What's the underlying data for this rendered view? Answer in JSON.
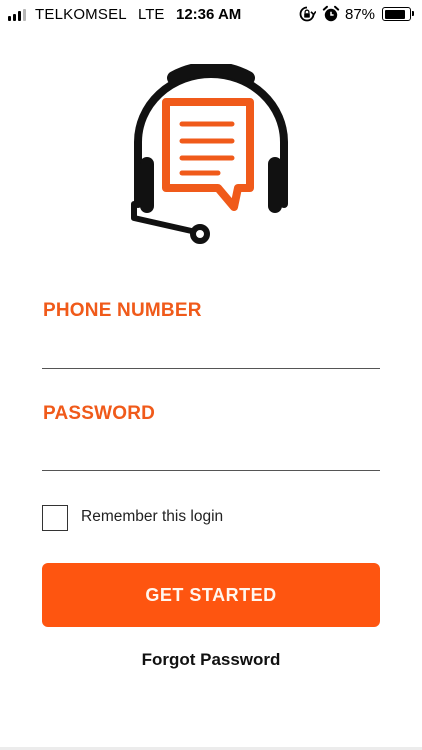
{
  "status_bar": {
    "carrier": "TELKOMSEL",
    "network": "LTE",
    "time": "12:36 AM",
    "battery_percent": "87%",
    "battery_level": 0.87,
    "signal_bars_filled": 3,
    "signal_bars_total": 4,
    "icons": [
      "signal-icon",
      "rotation-lock-icon",
      "alarm-icon",
      "battery-icon"
    ]
  },
  "logo": {
    "icon": "headset-chat-icon",
    "colors": {
      "outline": "#111111",
      "accent": "#f05a1a"
    }
  },
  "form": {
    "phone": {
      "label": "PHONE NUMBER",
      "value": "",
      "placeholder": ""
    },
    "password": {
      "label": "PASSWORD",
      "value": "",
      "placeholder": ""
    },
    "remember": {
      "label": "Remember this login",
      "checked": false
    },
    "submit_label": "GET STARTED",
    "forgot_label": "Forgot Password"
  },
  "colors": {
    "accent": "#f05a1a",
    "button": "#fe5510",
    "text": "#111111"
  }
}
